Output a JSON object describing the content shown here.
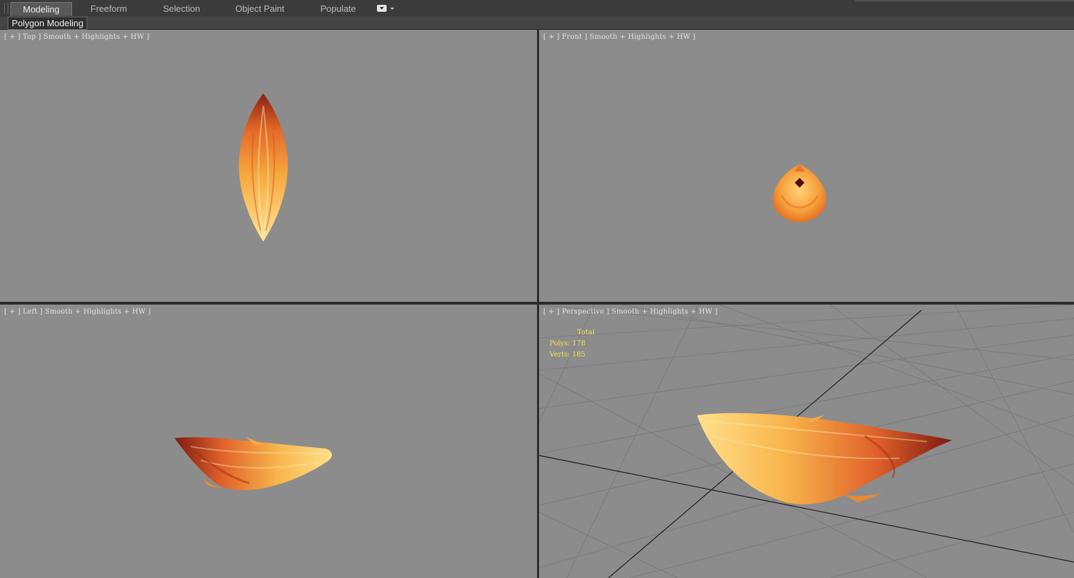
{
  "ribbon": {
    "tabs": [
      "Modeling",
      "Freeform",
      "Selection",
      "Object Paint",
      "Populate"
    ],
    "active_tab": "Modeling",
    "panel_label": "Polygon Modeling"
  },
  "viewports": {
    "top": {
      "label": "[ + ] Top ] Smooth + Highlights + HW ]"
    },
    "front": {
      "label": "[ + ] Front ] Smooth + Highlights + HW ]"
    },
    "left": {
      "label": "[ + ] Left ] Smooth + Highlights + HW ]"
    },
    "perspective": {
      "label": "[ + ] Perspective ] Smooth + Highlights + HW ]",
      "stats_title": "Total",
      "polys": "Polys: 178",
      "verts": "Verts: 185"
    }
  },
  "colors": {
    "viewport_bg": "#8c8c8c",
    "stats_text": "#f3e34a",
    "petal_light": "#ffe089",
    "petal_mid": "#f5a23c",
    "petal_dark": "#8a1f12"
  }
}
